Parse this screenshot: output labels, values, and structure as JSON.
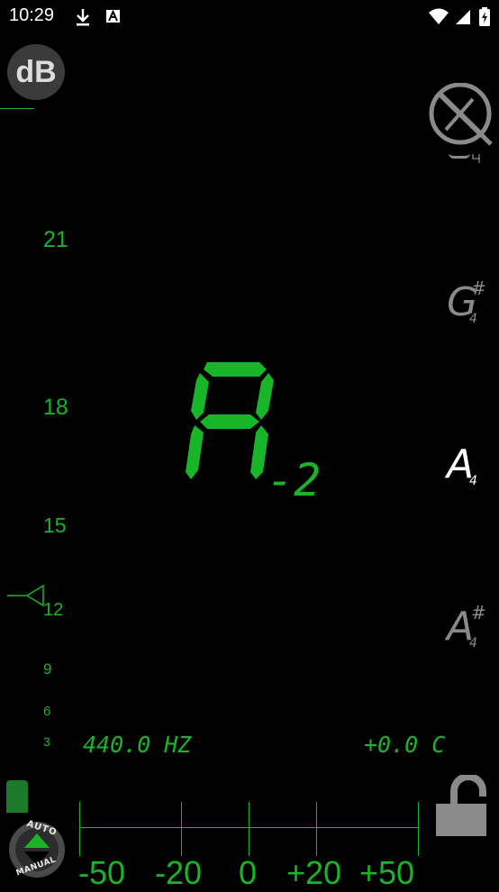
{
  "status_bar": {
    "time": "10:29"
  },
  "db_button": {
    "label": "dB"
  },
  "level_scale": [
    "21",
    "18",
    "15",
    "12",
    "9",
    "6",
    "3"
  ],
  "main_note": {
    "note": "A",
    "octave": "-2"
  },
  "note_strip": [
    {
      "note": "G",
      "accidental": "#",
      "octave": "4"
    },
    {
      "note": "A",
      "accidental": "",
      "octave": "4"
    },
    {
      "note": "A",
      "accidental": "#",
      "octave": "4"
    }
  ],
  "readouts": {
    "frequency": "440.0 HZ",
    "cents": "+0.0 C"
  },
  "mode_button": {
    "top": "AUTO",
    "bottom": "MANUAL"
  },
  "cent_scale": [
    "-50",
    "-20",
    "0",
    "+20",
    "+50"
  ],
  "colors": {
    "accent": "#19b528",
    "background": "#000000",
    "inactive": "#8a8a8a"
  }
}
